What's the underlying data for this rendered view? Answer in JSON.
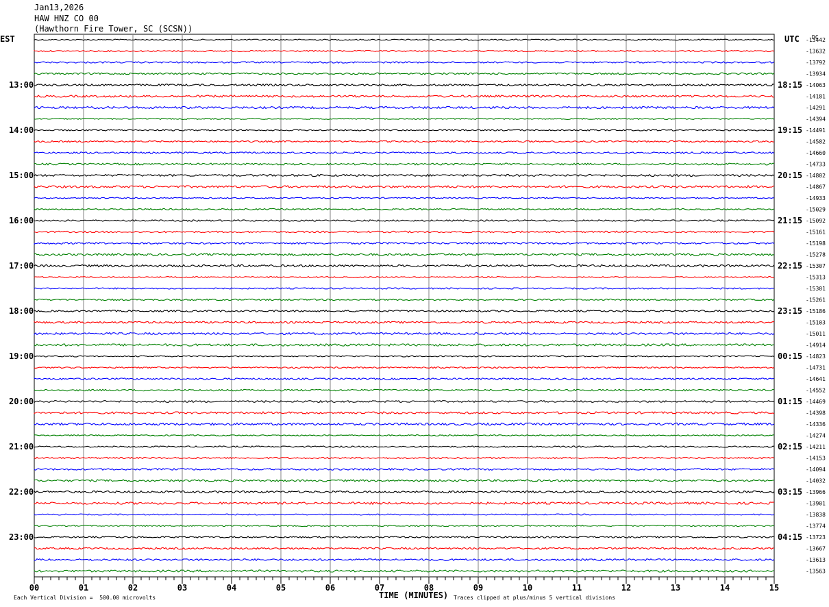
{
  "header": {
    "date": "Jan13,2026",
    "station": "HAW HNZ CO 00",
    "location": "(Hawthorn Fire Tower, SC (SCSN))"
  },
  "chart_data": {
    "type": "line",
    "description_free": true,
    "left_timezone": "EST",
    "right_timezone": "UTC",
    "dc_label": "DC",
    "xlabel": "TIME (MINUTES)",
    "xlim": [
      0,
      15
    ],
    "x_ticks": [
      "00",
      "01",
      "02",
      "03",
      "04",
      "05",
      "06",
      "07",
      "08",
      "09",
      "10",
      "11",
      "12",
      "13",
      "14",
      "15"
    ],
    "left_hour_labels": [
      "13:00",
      "14:00",
      "15:00",
      "16:00",
      "17:00",
      "18:00",
      "19:00",
      "20:00",
      "21:00",
      "22:00",
      "23:00"
    ],
    "right_hour_labels": [
      "18:15",
      "19:15",
      "20:15",
      "21:15",
      "22:15",
      "23:15",
      "00:15",
      "01:15",
      "02:15",
      "03:15",
      "04:15"
    ],
    "trace_colors": [
      "#000000",
      "#ff0000",
      "#0000ff",
      "#008000"
    ],
    "dc_offsets": [
      "-13442",
      "-13632",
      "-13792",
      "-13934",
      "-14063",
      "-14181",
      "-14291",
      "-14394",
      "-14491",
      "-14582",
      "-14660",
      "-14733",
      "-14802",
      "-14867",
      "-14933",
      "-15029",
      "-15092",
      "-15161",
      "-15198",
      "-15278",
      "-15307",
      "-15313",
      "-15301",
      "-15261",
      "-15186",
      "-15103",
      "-15011",
      "-14914",
      "-14823",
      "-14731",
      "-14641",
      "-14552",
      "-14469",
      "-14398",
      "-14336",
      "-14274",
      "-14211",
      "-14153",
      "-14094",
      "-14032",
      "-13966",
      "-13901",
      "-13838",
      "-13774",
      "-13723",
      "-13667",
      "-13613",
      "-13563"
    ],
    "trace_count": 48,
    "first_labeled_trace_index": 4,
    "traces_per_hour": 4,
    "grid": true
  },
  "footer": {
    "scale": "Each Vertical Division =  500.00 microvolts",
    "clip": "Traces clipped at plus/minus 5 vertical divisions"
  }
}
